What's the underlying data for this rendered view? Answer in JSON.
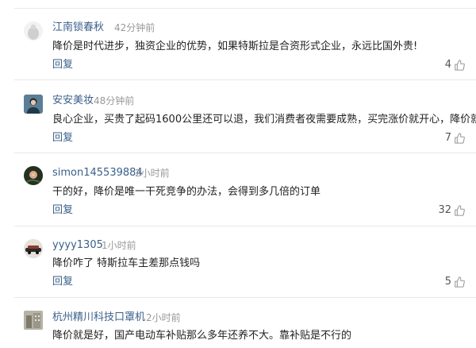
{
  "comments": [
    {
      "username": "江南锁春秋",
      "time": "42分钟前",
      "text": "降价是时代进步，独资企业的优势，如果特斯拉是合资形式企业，永远比国外贵!",
      "reply": "回复",
      "likes": "4",
      "avatar_icon": "avatar-white-figure",
      "avatar_color": "#c9c9c9"
    },
    {
      "username": "安安美妆",
      "time": "48分钟前",
      "text": "良心企业，买贵了起码1600公里还可以退，我们消费者夜需要成熟，买完涨价就开心，降价就闹.",
      "reply": "回复",
      "likes": "7",
      "avatar_icon": "avatar-person-photo",
      "avatar_color": "#4a6f8e"
    },
    {
      "username": "simon145539884",
      "time": "2小时前",
      "text": "干的好，降价是唯一干死竞争的办法，会得到多几倍的订单",
      "reply": "回复",
      "likes": "32",
      "avatar_icon": "avatar-flower-photo",
      "avatar_color": "#2f3a2a"
    },
    {
      "username": "yyyy1305",
      "time": "1小时前",
      "text": "降价咋了 特斯拉车主差那点钱吗",
      "reply": "回复",
      "likes": "5",
      "avatar_icon": "avatar-car-photo",
      "avatar_color": "#7a5a4a"
    },
    {
      "username": "杭州精川科技口罩机",
      "time": "2小时前",
      "text": "降价就是好，国产电动车补贴那么多年还养不大。靠补贴是不行的",
      "reply": "",
      "likes": "",
      "avatar_icon": "avatar-building-photo",
      "avatar_color": "#8a8a7a"
    }
  ]
}
